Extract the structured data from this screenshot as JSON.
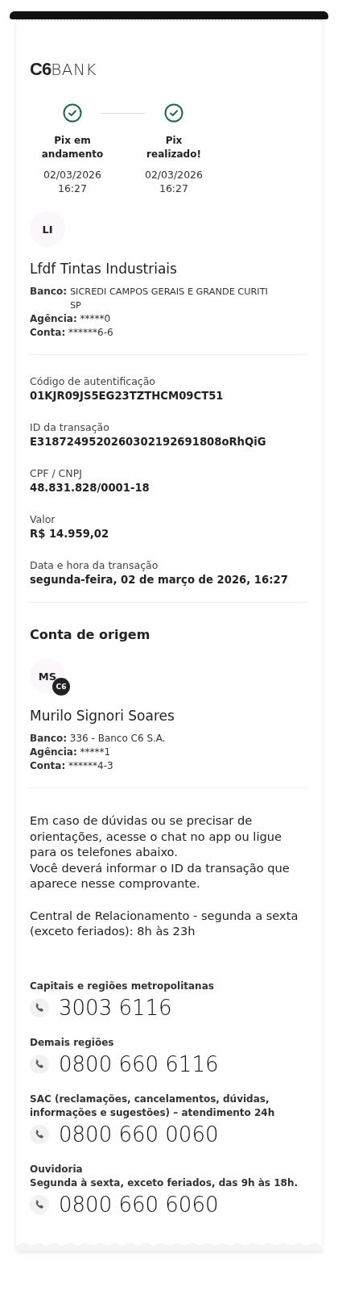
{
  "logo": {
    "mark": "C6",
    "word": "BANK"
  },
  "steps": [
    {
      "title": "Pix em andamento",
      "date": "02/03/2026",
      "time": "16:27",
      "completed": true
    },
    {
      "title": "Pix realizado!",
      "date": "02/03/2026",
      "time": "16:27",
      "completed": true
    }
  ],
  "recipient": {
    "initials": "LI",
    "name": "Lfdf Tintas Industriais",
    "bank_label": "Banco:",
    "bank": "SICREDI CAMPOS GERAIS E GRANDE CURITI",
    "bank_line2": "SP",
    "agency_label": "Agência:",
    "agency": "*****0",
    "account_label": "Conta:",
    "account": "******6-6"
  },
  "details": [
    {
      "label": "Código de autentificação",
      "value": "01KJR09JS5EG23TZTHCM09CT51"
    },
    {
      "label": "ID da transação",
      "value": "E3187249520260302192691808oRhQiG"
    },
    {
      "label": "CPF / CNPJ",
      "value": "48.831.828/0001-18"
    },
    {
      "label": "Valor",
      "value": "R$ 14.959,02"
    },
    {
      "label": "Data e hora da transação",
      "value": "segunda-feira, 02 de março de 2026, 16:27"
    }
  ],
  "origin": {
    "heading": "Conta de origem",
    "initials": "MS",
    "badge": "C6",
    "name": "Murilo Signori Soares",
    "bank_label": "Banco:",
    "bank": "336 - Banco C6 S.A.",
    "agency_label": "Agência:",
    "agency": "*****1",
    "account_label": "Conta:",
    "account": "******4-3"
  },
  "help": {
    "paragraph": "Em caso de dúvidas ou se precisar de orientações, acesse o chat no app ou ligue para os telefones abaixo.",
    "paragraph_2": "Você deverá informar o ID da transação que aparece nesse comprovante.",
    "hours": "Central de Relacionamento - segunda a sexta (exceto feriados): 8h às 23h"
  },
  "contacts": [
    {
      "label": "Capitais e regiões metropolitanas",
      "phone": "3003 6116"
    },
    {
      "label": "Demais regiões",
      "phone": "0800 660 6116"
    },
    {
      "label": "SAC (reclamações, cancelamentos, dúvidas, informações e sugestões) – atendimento 24h",
      "phone": "0800 660 0060"
    },
    {
      "label": "Ouvidoria",
      "sublabel": "Segunda à sexta, exceto feriados, das 9h às 18h.",
      "phone": "0800 660 6060"
    }
  ]
}
